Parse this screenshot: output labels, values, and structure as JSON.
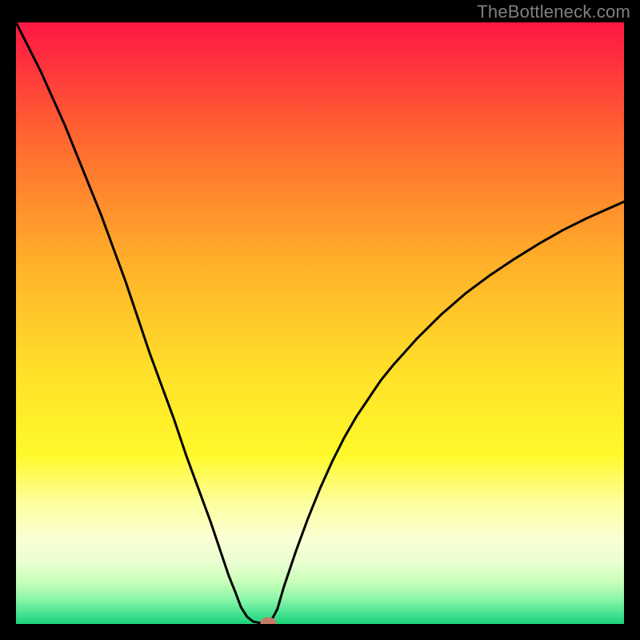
{
  "watermark": "TheBottleneck.com",
  "chart_data": {
    "type": "line",
    "title": "",
    "xlabel": "",
    "ylabel": "",
    "xlim": [
      0,
      100
    ],
    "ylim": [
      0,
      100
    ],
    "series": [
      {
        "name": "bottleneck-curve",
        "x": [
          0,
          2,
          4,
          6,
          8,
          10,
          12,
          14,
          16,
          18,
          20,
          22,
          24,
          26,
          28,
          30,
          32,
          34,
          35,
          36,
          37,
          38,
          39,
          40,
          41,
          42,
          43,
          44,
          46,
          48,
          50,
          52,
          54,
          56,
          58,
          60,
          62,
          66,
          70,
          74,
          78,
          82,
          86,
          90,
          94,
          98,
          100
        ],
        "y": [
          100,
          96,
          92,
          87.5,
          83,
          78,
          73,
          68,
          62.5,
          57,
          51,
          45,
          39.5,
          34,
          28,
          22.5,
          17,
          11,
          8,
          5.5,
          2.8,
          1.2,
          0.4,
          0.2,
          0.2,
          0.6,
          2.5,
          6,
          12,
          17.5,
          22.5,
          27,
          31,
          34.5,
          37.5,
          40.5,
          43,
          47.5,
          51.5,
          55,
          58,
          60.7,
          63.2,
          65.5,
          67.5,
          69.3,
          70.2
        ]
      }
    ],
    "marker": {
      "x": 41.5,
      "y": 0.2,
      "color": "#c47a6a"
    },
    "gradient_stops": [
      {
        "offset": 0.0,
        "color": "#ff1744"
      },
      {
        "offset": 0.05,
        "color": "#ff2a3f"
      },
      {
        "offset": 0.2,
        "color": "#ff6a2f"
      },
      {
        "offset": 0.4,
        "color": "#ffb02a"
      },
      {
        "offset": 0.58,
        "color": "#ffe029"
      },
      {
        "offset": 0.72,
        "color": "#fff92b"
      },
      {
        "offset": 0.8,
        "color": "#fdffa0"
      },
      {
        "offset": 0.86,
        "color": "#fbffd6"
      },
      {
        "offset": 0.9,
        "color": "#e8ffd0"
      },
      {
        "offset": 0.93,
        "color": "#c8ffb8"
      },
      {
        "offset": 0.96,
        "color": "#88f5a8"
      },
      {
        "offset": 0.985,
        "color": "#3fe08e"
      },
      {
        "offset": 1.0,
        "color": "#1fd17a"
      }
    ],
    "curve_color": "#000000",
    "curve_width": 3
  }
}
